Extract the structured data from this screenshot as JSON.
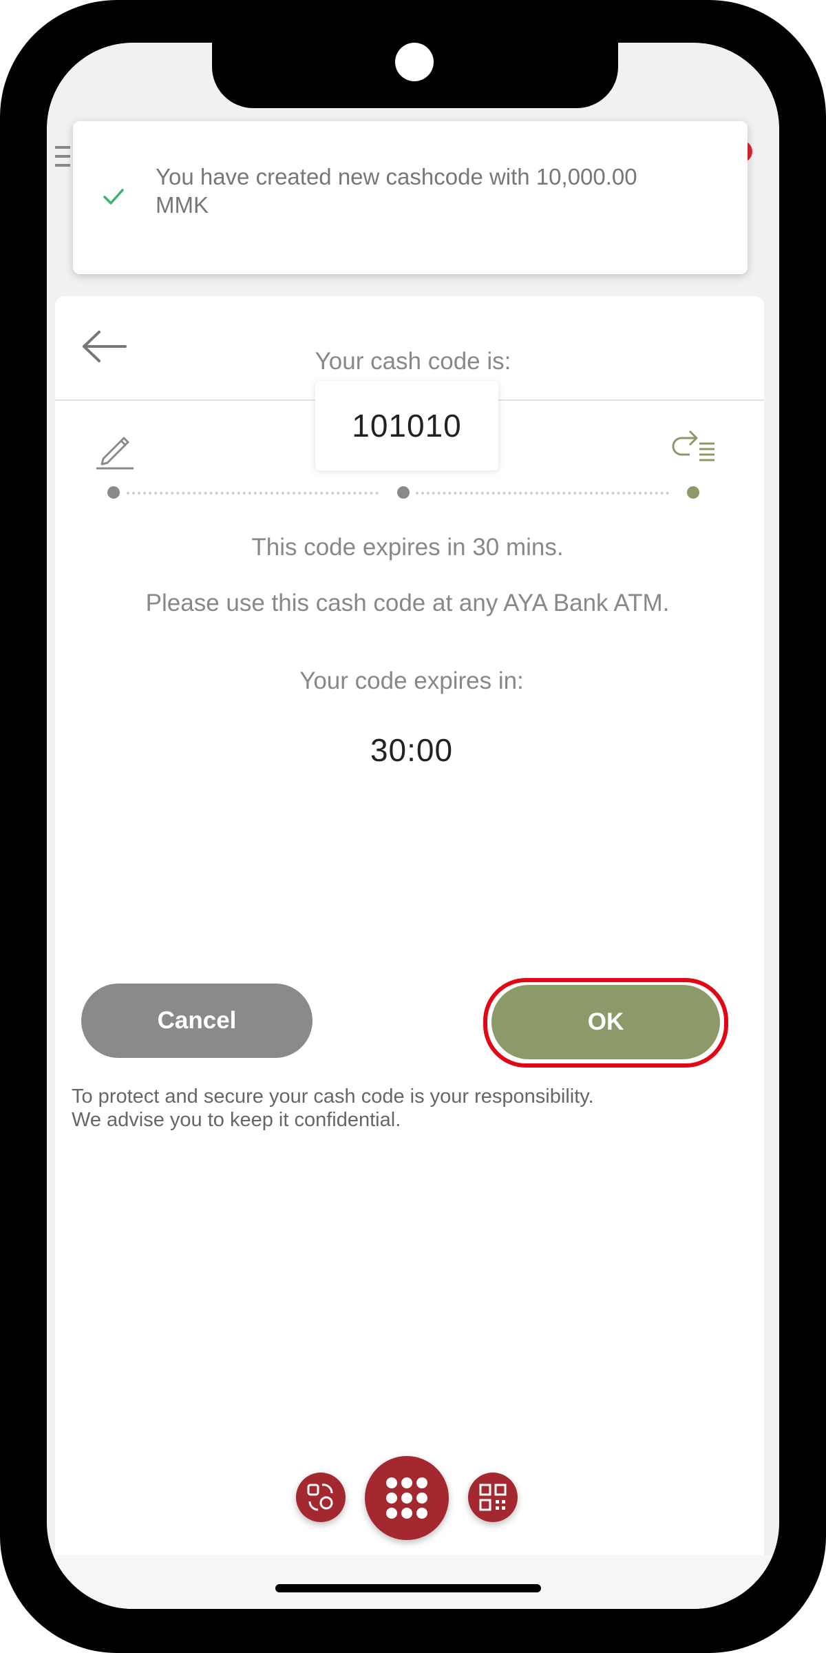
{
  "toast": {
    "message": "You have created new cashcode with 10,000.00 MMK",
    "icon": "check-icon"
  },
  "header": {
    "back_icon": "back-arrow-icon"
  },
  "stepper": {
    "steps": [
      {
        "icon": "pencil-icon",
        "state": "done"
      },
      {
        "icon": "verified-badge-icon",
        "state": "done"
      },
      {
        "icon": "confirm-list-icon",
        "state": "active"
      }
    ]
  },
  "main": {
    "code_label": "Your cash code is:",
    "code_value": "101010",
    "expiry_note": "This code expires in 30 mins.",
    "usage_note": "Please use this cash code at any AYA Bank ATM.",
    "timer_label": "Your code expires in:",
    "timer_value": "30:00"
  },
  "actions": {
    "cancel_label": "Cancel",
    "ok_label": "OK"
  },
  "footer_note": {
    "line1": "To protect and secure your cash code is your responsibility.",
    "line2": "We advise you to keep it confidential."
  },
  "bottom_nav": {
    "left_icon": "transfer-icon",
    "center_icon": "apps-grid-icon",
    "right_icon": "qr-code-icon"
  },
  "colors": {
    "accent_green": "#8c9a6a",
    "brand_red": "#a3282f",
    "highlight_red": "#e30613",
    "cancel_gray": "#8a8a8a"
  }
}
